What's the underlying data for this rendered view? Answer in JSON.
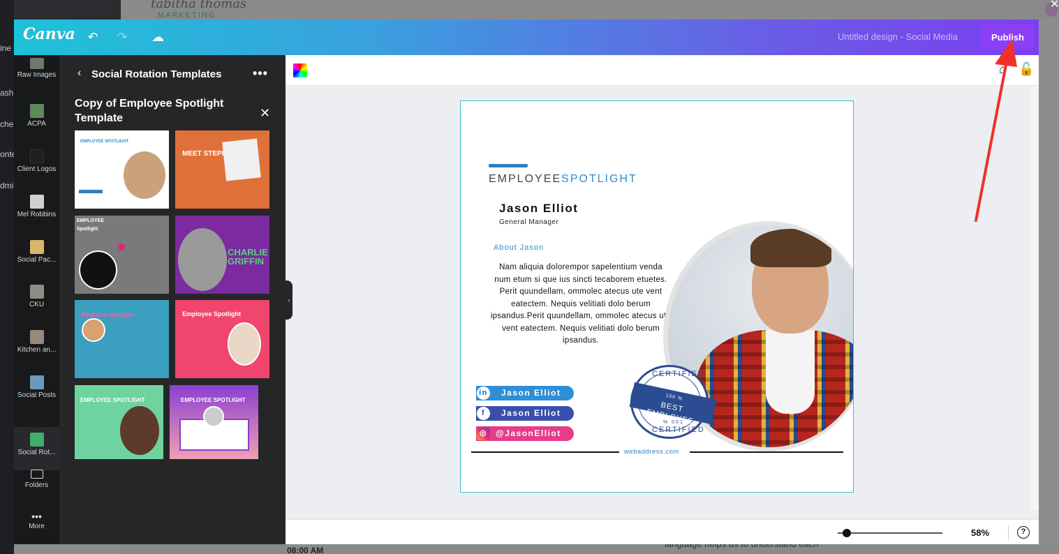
{
  "background": {
    "logo_line1": "tabitha thomas",
    "logo_line2": "MARKETING",
    "side_labels": [
      "ine",
      "ashl",
      "che",
      "onte",
      "dmi"
    ],
    "time": "08:00 AM",
    "snippet": "language helps us to understand each"
  },
  "topbar": {
    "brand": "Canva",
    "undo_icon": "undo-icon",
    "redo_icon": "redo-icon",
    "cloud_icon": "cloud-check-icon",
    "design_title": "Untitled design - Social Media",
    "publish_label": "Publish",
    "gradient_start": "#1ec2d8",
    "gradient_end": "#7c3ff0",
    "publish_color": "#8b3ff6"
  },
  "rail": {
    "items": [
      {
        "label": "Raw Images"
      },
      {
        "label": "ACPA"
      },
      {
        "label": "Client Logos"
      },
      {
        "label": "Mel Robbins"
      },
      {
        "label": "Social Pac..."
      },
      {
        "label": "CKU"
      },
      {
        "label": "Kitchen an..."
      },
      {
        "label": "Social Posts"
      },
      {
        "label": "Social Rot..."
      },
      {
        "label": "Folders"
      },
      {
        "label": "More"
      }
    ]
  },
  "panel": {
    "header": "Social Rotation Templates",
    "subheader": "Copy of Employee Spotlight Template",
    "templates": [
      {
        "text": "EMPLOYEE SPOTLIGHT"
      },
      {
        "text": "MEET STEPHANIE"
      },
      {
        "text": "EMPLOYEE Spotlight"
      },
      {
        "text": "CHARLIE GRIFFIN"
      },
      {
        "text": "Employee Spotlight"
      },
      {
        "text": "Employee Spotlight"
      },
      {
        "text": "EMPLOYEE SPOTLIGHT"
      },
      {
        "text": "EMPLOYEE SPOTLIGHT"
      }
    ]
  },
  "design": {
    "title_a": "EMPLOYEE",
    "title_b": "SPOTLIGHT",
    "name": "Jason Elliot",
    "role": "General Manager",
    "about": "About Jason",
    "bio": "Nam aliquia dolorempor sapelentium venda num etum si que ius sincti tecaborem etuetes. Perit quundellam, ommolec atecus ute vent eatectem. Nequis velitiati dolo berum ipsandus.Perit quundellam, ommolec atecus ute vent eatectem. Nequis velitiati dolo berum ipsandus.",
    "badge_top": "CERTIFIED",
    "badge_line1": "100 %",
    "badge_line2": "BEST",
    "badge_line3": "EMPLOYEE",
    "badge_line4": "% 001",
    "badge_bottom": "CERTIFIED",
    "linkedin": "Jason Elliot",
    "facebook": "Jason Elliot",
    "instagram": "@JasonElliot",
    "website": "webaddress.com",
    "accent": "#2f8bc9",
    "badge_color": "#2b4c93"
  },
  "footer": {
    "zoom_label": "58%",
    "help_label": "?"
  }
}
